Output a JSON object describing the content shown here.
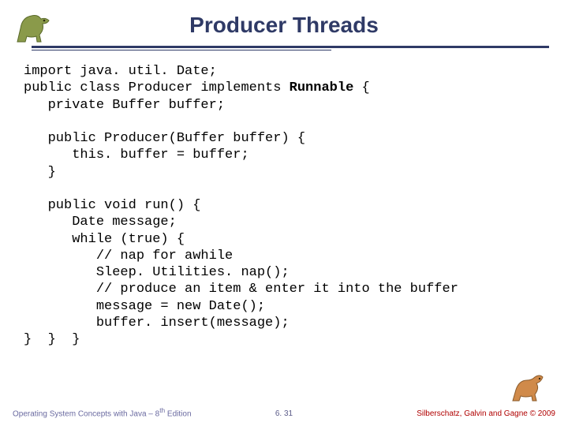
{
  "title": "Producer Threads",
  "code": {
    "l1": "import java. util. Date;",
    "l2": "public class Producer implements ",
    "l2b": "Runnable",
    "l2c": " {",
    "l3": "   private Buffer buffer;",
    "l4": "",
    "l5": "   public Producer(Buffer buffer) {",
    "l6": "      this. buffer = buffer;",
    "l7": "   }",
    "l8": "",
    "l9": "   public void run() {",
    "l10": "      Date message;",
    "l11": "      while (true) {",
    "l12": "         // nap for awhile",
    "l13": "         Sleep. Utilities. nap();",
    "l14": "         // produce an item & enter it into the buffer",
    "l15": "         message = new Date();",
    "l16": "         buffer. insert(message);",
    "l17": "}  }  }"
  },
  "footer": {
    "left": "Operating System Concepts with Java – 8",
    "left_sup": "th",
    "left2": " Edition",
    "center": "6. 31",
    "right": "Silberschatz, Galvin and Gagne © 2009"
  }
}
